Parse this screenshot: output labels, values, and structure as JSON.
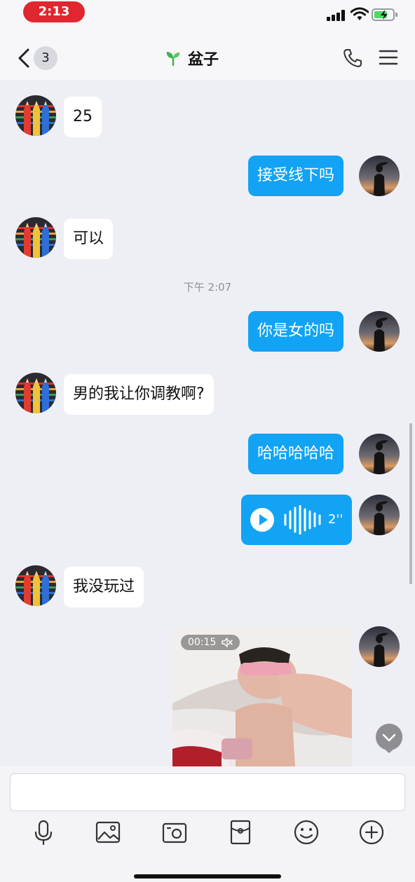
{
  "status_bar": {
    "time": "2:13"
  },
  "header": {
    "unread_count": "3",
    "title": "盆子",
    "title_icon": "sprout-icon",
    "accent_color": "#12a3f5"
  },
  "messages": [
    {
      "side": "in",
      "type": "text",
      "text": "25"
    },
    {
      "side": "out",
      "type": "text",
      "text": "接受线下吗"
    },
    {
      "side": "in",
      "type": "text",
      "text": "可以"
    },
    {
      "type": "timestamp",
      "text": "下午 2:07"
    },
    {
      "side": "out",
      "type": "text",
      "text": "你是女的吗"
    },
    {
      "side": "in",
      "type": "text",
      "text": "男的我让你调教啊?"
    },
    {
      "side": "out",
      "type": "text",
      "text": "哈哈哈哈哈"
    },
    {
      "side": "out",
      "type": "voice",
      "duration": "2''"
    },
    {
      "side": "in",
      "type": "text",
      "text": "我没玩过"
    },
    {
      "side": "out",
      "type": "video",
      "duration": "00:15",
      "muted_icon": "muted-speaker-icon"
    }
  ],
  "input": {
    "placeholder": ""
  },
  "toolbar": [
    "mic-icon",
    "photo-icon",
    "camera-icon",
    "red-packet-icon",
    "emoji-icon",
    "plus-icon"
  ]
}
